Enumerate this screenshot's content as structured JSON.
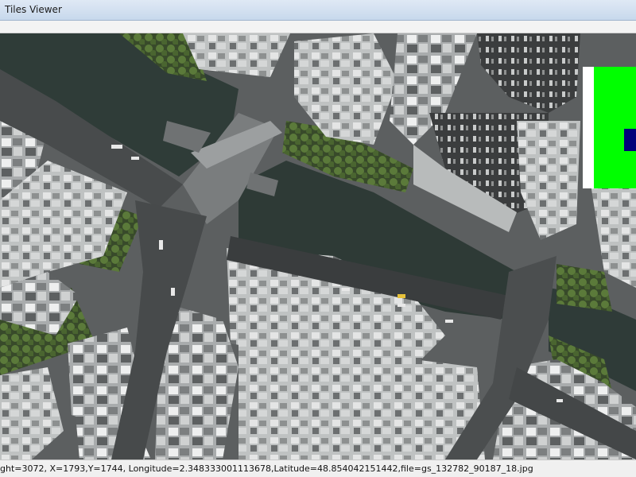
{
  "window": {
    "title": "Tiles Viewer"
  },
  "status": {
    "text": "ght=3072, X=1793,Y=1744, Longitude=2.348333001113678,Latitude=48.854042151442,file=gs_132782_90187_18.jpg"
  },
  "map": {
    "type": "aerial satellite tile",
    "colors": {
      "water": "#2e3a37",
      "road": "#4a4c4d",
      "roof": "#cfd1d1",
      "tree": "#3f5a2c"
    }
  },
  "minimap": {
    "colors": {
      "background": "#ffffff",
      "area": "#00ff00",
      "marker": "#00007a"
    }
  }
}
